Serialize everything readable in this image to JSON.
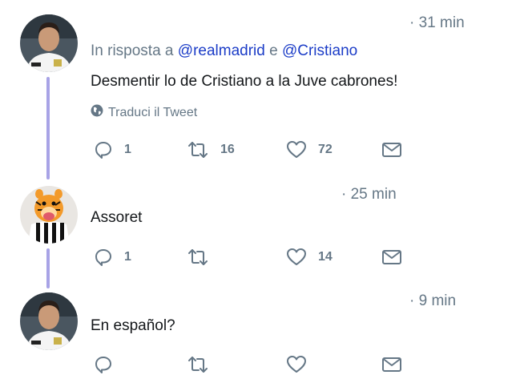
{
  "tweets": [
    {
      "time": "· 31 min",
      "reply_to": {
        "prefix": "In risposta a",
        "mention1": "@realmadrid",
        "conj": "e",
        "mention2": "@Cristiano"
      },
      "text": "Desmentir lo de Cristiano a la Juve cabrones!",
      "translate_label": "Traduci il Tweet",
      "actions": {
        "reply_count": "1",
        "retweet_count": "16",
        "like_count": "72"
      }
    },
    {
      "time": "· 25 min",
      "text": "Assoret",
      "actions": {
        "reply_count": "1",
        "retweet_count": "",
        "like_count": "14"
      }
    },
    {
      "time": "· 9 min",
      "text": "En español?",
      "actions": {
        "reply_count": "",
        "retweet_count": "",
        "like_count": ""
      }
    }
  ],
  "icons": {
    "reply": "reply-icon",
    "retweet": "retweet-icon",
    "like": "heart-icon",
    "dm": "envelope-icon",
    "translate": "globe-icon"
  },
  "colors": {
    "mention": "#1b3cc7",
    "muted": "#657786",
    "thread_line": "#a8a3e6",
    "text": "#14171a"
  }
}
